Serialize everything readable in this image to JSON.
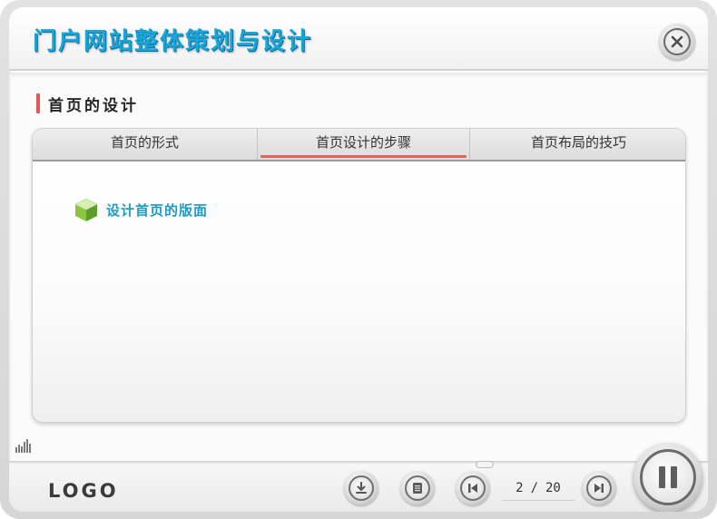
{
  "window": {
    "title": "门户网站整体策划与设计",
    "close_icon": "close-icon"
  },
  "section": {
    "title": "首页的设计",
    "accent_color": "#e35757"
  },
  "tabs": [
    {
      "label": "首页的形式",
      "active": false
    },
    {
      "label": "首页设计的步骤",
      "active": true
    },
    {
      "label": "首页布局的技巧",
      "active": false
    }
  ],
  "content": {
    "items": [
      {
        "icon": "cube-icon",
        "label": "设计首页的版面"
      }
    ],
    "link_color": "#1f9ac6"
  },
  "footer": {
    "logo": "LOGO",
    "buttons": [
      {
        "name": "download-button",
        "icon": "download-icon"
      },
      {
        "name": "menu-button",
        "icon": "list-icon"
      },
      {
        "name": "previous-button",
        "icon": "previous-icon"
      },
      {
        "name": "next-button",
        "icon": "next-icon"
      },
      {
        "name": "pause-button",
        "icon": "pause-icon"
      }
    ],
    "page": {
      "current": "2",
      "separator": "/",
      "total": "20"
    },
    "equalizer_icon": "equalizer-icon"
  },
  "colors": {
    "title": "#17a6d7",
    "tab_underline": "#e06262"
  }
}
